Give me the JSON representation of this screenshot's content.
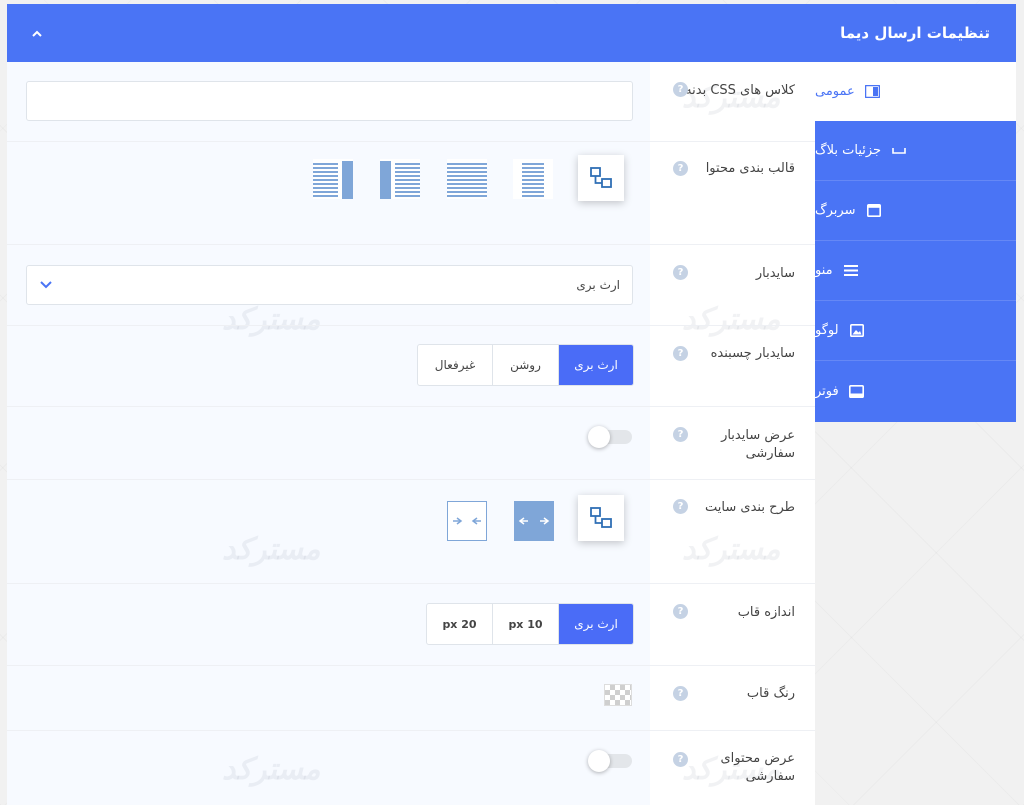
{
  "header": {
    "title": "تنظیمات ارسال دیما"
  },
  "sidebar": {
    "items": [
      {
        "label": "عمومی",
        "icon": "columns-icon",
        "active": true
      },
      {
        "label": "جزئیات بلاگ",
        "icon": "minus-box-icon",
        "active": false
      },
      {
        "label": "سربرگ",
        "icon": "window-icon",
        "active": false
      },
      {
        "label": "منو",
        "icon": "menu-icon",
        "active": false
      },
      {
        "label": "لوگو",
        "icon": "image-icon",
        "active": false
      },
      {
        "label": "فوتر",
        "icon": "footer-icon",
        "active": false
      }
    ]
  },
  "rows": {
    "css_class": {
      "label": "کلاس های CSS بدنه",
      "value": ""
    },
    "content_layout": {
      "label": "قالب بندی محتوا"
    },
    "sidebar": {
      "label": "سایدبار",
      "selected": "ارث بری"
    },
    "sticky_sidebar": {
      "label": "سایدبار چسبنده",
      "options": [
        "ارث بری",
        "روشن",
        "غیرفعال"
      ],
      "selected": "ارث بری"
    },
    "custom_sidebar_width": {
      "label": "عرض سایدبار سفارشی",
      "enabled": false
    },
    "site_layout": {
      "label": "طرح بندی سایت"
    },
    "frame_size": {
      "label": "اندازه قاب",
      "options": [
        "ارث بری",
        "10 px",
        "20 px"
      ],
      "selected": "ارث بری"
    },
    "frame_color": {
      "label": "رنگ قاب"
    },
    "custom_content_width": {
      "label": "عرض محتوای سفارشی",
      "enabled": false
    }
  },
  "help_glyph": "?",
  "watermark": "مسترکد",
  "colors": {
    "accent": "#4a74f5",
    "active_segment": "#4a6cf7",
    "layout_icon": "#7fa6d8"
  }
}
